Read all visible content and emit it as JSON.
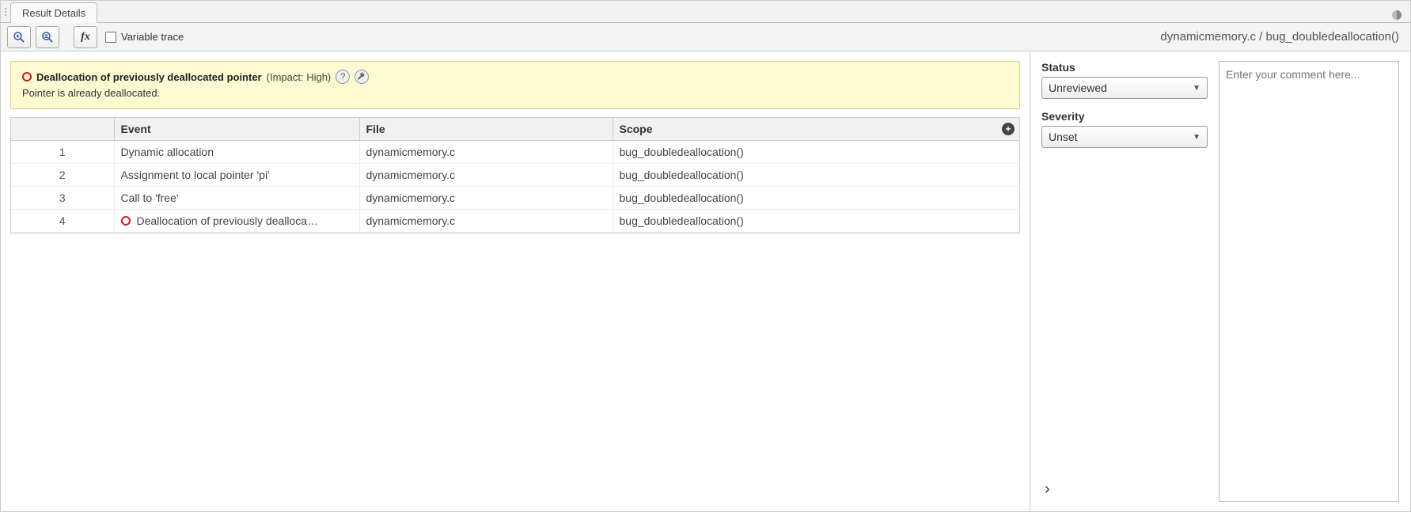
{
  "tab": {
    "title": "Result Details"
  },
  "toolbar": {
    "variable_trace_label": "Variable trace",
    "fx_label": "fx"
  },
  "breadcrumb": {
    "file": "dynamicmemory.c",
    "sep": " / ",
    "scope": "bug_doubledeallocation()"
  },
  "banner": {
    "title": "Deallocation of previously deallocated pointer",
    "impact_text": "(Impact: High)",
    "detail": "Pointer is already deallocated."
  },
  "table": {
    "headers": {
      "num": "",
      "event": "Event",
      "file": "File",
      "scope": "Scope"
    },
    "rows": [
      {
        "num": "1",
        "event": "Dynamic allocation",
        "file": "dynamicmemory.c",
        "scope": "bug_doubledeallocation()",
        "flagged": false
      },
      {
        "num": "2",
        "event": "Assignment to local pointer 'pi'",
        "file": "dynamicmemory.c",
        "scope": "bug_doubledeallocation()",
        "flagged": false
      },
      {
        "num": "3",
        "event": "Call to 'free'",
        "file": "dynamicmemory.c",
        "scope": "bug_doubledeallocation()",
        "flagged": false
      },
      {
        "num": "4",
        "event": "Deallocation of previously dealloca…",
        "file": "dynamicmemory.c",
        "scope": "bug_doubledeallocation()",
        "flagged": true
      }
    ]
  },
  "side": {
    "status_label": "Status",
    "status_value": "Unreviewed",
    "severity_label": "Severity",
    "severity_value": "Unset",
    "comment_placeholder": "Enter your comment here..."
  },
  "icons": {
    "help_glyph": "?",
    "wrench_glyph": "🔧",
    "add_glyph": "+",
    "caret_glyph": "▼",
    "chevron_glyph": "›",
    "minimize_glyph": "◑"
  }
}
